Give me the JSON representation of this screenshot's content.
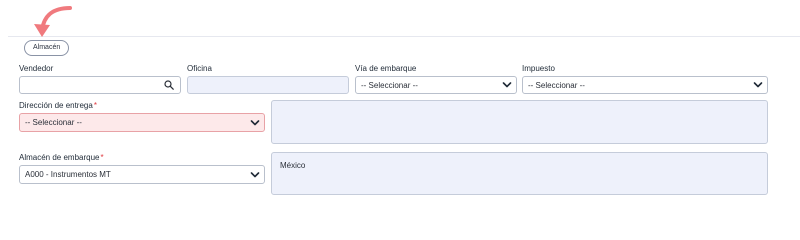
{
  "tab": {
    "label": "Almacén"
  },
  "form": {
    "vendedor": {
      "label": "Vendedor",
      "value": ""
    },
    "oficina": {
      "label": "Oficina",
      "value": ""
    },
    "via_embarque": {
      "label": "Vía de embarque",
      "value": "-- Seleccionar --"
    },
    "impuesto": {
      "label": "Impuesto",
      "value": "-- Seleccionar --"
    },
    "direccion_entrega": {
      "label": "Dirección de entrega",
      "required_mark": "*",
      "value": "-- Seleccionar --"
    },
    "direccion_detalle": {
      "value": ""
    },
    "almacen_embarque": {
      "label": "Almacén de embarque",
      "required_mark": "*",
      "value": "A000 - Instrumentos MT"
    },
    "almacen_detalle": {
      "value": "México"
    }
  },
  "colors": {
    "arrow": "#f07a7e",
    "error_bg": "#fde9ea",
    "readonly_bg": "#eef1fb",
    "required": "#e0383e"
  }
}
